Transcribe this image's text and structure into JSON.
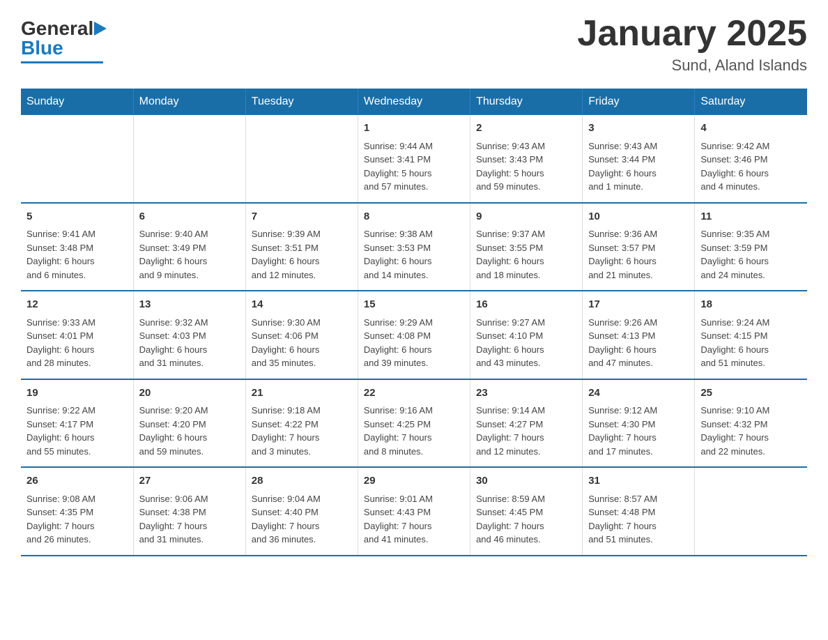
{
  "header": {
    "logo_general": "General",
    "logo_blue": "Blue",
    "title": "January 2025",
    "subtitle": "Sund, Aland Islands"
  },
  "calendar": {
    "weekdays": [
      "Sunday",
      "Monday",
      "Tuesday",
      "Wednesday",
      "Thursday",
      "Friday",
      "Saturday"
    ],
    "weeks": [
      [
        {
          "day": "",
          "info": ""
        },
        {
          "day": "",
          "info": ""
        },
        {
          "day": "",
          "info": ""
        },
        {
          "day": "1",
          "info": "Sunrise: 9:44 AM\nSunset: 3:41 PM\nDaylight: 5 hours\nand 57 minutes."
        },
        {
          "day": "2",
          "info": "Sunrise: 9:43 AM\nSunset: 3:43 PM\nDaylight: 5 hours\nand 59 minutes."
        },
        {
          "day": "3",
          "info": "Sunrise: 9:43 AM\nSunset: 3:44 PM\nDaylight: 6 hours\nand 1 minute."
        },
        {
          "day": "4",
          "info": "Sunrise: 9:42 AM\nSunset: 3:46 PM\nDaylight: 6 hours\nand 4 minutes."
        }
      ],
      [
        {
          "day": "5",
          "info": "Sunrise: 9:41 AM\nSunset: 3:48 PM\nDaylight: 6 hours\nand 6 minutes."
        },
        {
          "day": "6",
          "info": "Sunrise: 9:40 AM\nSunset: 3:49 PM\nDaylight: 6 hours\nand 9 minutes."
        },
        {
          "day": "7",
          "info": "Sunrise: 9:39 AM\nSunset: 3:51 PM\nDaylight: 6 hours\nand 12 minutes."
        },
        {
          "day": "8",
          "info": "Sunrise: 9:38 AM\nSunset: 3:53 PM\nDaylight: 6 hours\nand 14 minutes."
        },
        {
          "day": "9",
          "info": "Sunrise: 9:37 AM\nSunset: 3:55 PM\nDaylight: 6 hours\nand 18 minutes."
        },
        {
          "day": "10",
          "info": "Sunrise: 9:36 AM\nSunset: 3:57 PM\nDaylight: 6 hours\nand 21 minutes."
        },
        {
          "day": "11",
          "info": "Sunrise: 9:35 AM\nSunset: 3:59 PM\nDaylight: 6 hours\nand 24 minutes."
        }
      ],
      [
        {
          "day": "12",
          "info": "Sunrise: 9:33 AM\nSunset: 4:01 PM\nDaylight: 6 hours\nand 28 minutes."
        },
        {
          "day": "13",
          "info": "Sunrise: 9:32 AM\nSunset: 4:03 PM\nDaylight: 6 hours\nand 31 minutes."
        },
        {
          "day": "14",
          "info": "Sunrise: 9:30 AM\nSunset: 4:06 PM\nDaylight: 6 hours\nand 35 minutes."
        },
        {
          "day": "15",
          "info": "Sunrise: 9:29 AM\nSunset: 4:08 PM\nDaylight: 6 hours\nand 39 minutes."
        },
        {
          "day": "16",
          "info": "Sunrise: 9:27 AM\nSunset: 4:10 PM\nDaylight: 6 hours\nand 43 minutes."
        },
        {
          "day": "17",
          "info": "Sunrise: 9:26 AM\nSunset: 4:13 PM\nDaylight: 6 hours\nand 47 minutes."
        },
        {
          "day": "18",
          "info": "Sunrise: 9:24 AM\nSunset: 4:15 PM\nDaylight: 6 hours\nand 51 minutes."
        }
      ],
      [
        {
          "day": "19",
          "info": "Sunrise: 9:22 AM\nSunset: 4:17 PM\nDaylight: 6 hours\nand 55 minutes."
        },
        {
          "day": "20",
          "info": "Sunrise: 9:20 AM\nSunset: 4:20 PM\nDaylight: 6 hours\nand 59 minutes."
        },
        {
          "day": "21",
          "info": "Sunrise: 9:18 AM\nSunset: 4:22 PM\nDaylight: 7 hours\nand 3 minutes."
        },
        {
          "day": "22",
          "info": "Sunrise: 9:16 AM\nSunset: 4:25 PM\nDaylight: 7 hours\nand 8 minutes."
        },
        {
          "day": "23",
          "info": "Sunrise: 9:14 AM\nSunset: 4:27 PM\nDaylight: 7 hours\nand 12 minutes."
        },
        {
          "day": "24",
          "info": "Sunrise: 9:12 AM\nSunset: 4:30 PM\nDaylight: 7 hours\nand 17 minutes."
        },
        {
          "day": "25",
          "info": "Sunrise: 9:10 AM\nSunset: 4:32 PM\nDaylight: 7 hours\nand 22 minutes."
        }
      ],
      [
        {
          "day": "26",
          "info": "Sunrise: 9:08 AM\nSunset: 4:35 PM\nDaylight: 7 hours\nand 26 minutes."
        },
        {
          "day": "27",
          "info": "Sunrise: 9:06 AM\nSunset: 4:38 PM\nDaylight: 7 hours\nand 31 minutes."
        },
        {
          "day": "28",
          "info": "Sunrise: 9:04 AM\nSunset: 4:40 PM\nDaylight: 7 hours\nand 36 minutes."
        },
        {
          "day": "29",
          "info": "Sunrise: 9:01 AM\nSunset: 4:43 PM\nDaylight: 7 hours\nand 41 minutes."
        },
        {
          "day": "30",
          "info": "Sunrise: 8:59 AM\nSunset: 4:45 PM\nDaylight: 7 hours\nand 46 minutes."
        },
        {
          "day": "31",
          "info": "Sunrise: 8:57 AM\nSunset: 4:48 PM\nDaylight: 7 hours\nand 51 minutes."
        },
        {
          "day": "",
          "info": ""
        }
      ]
    ]
  }
}
